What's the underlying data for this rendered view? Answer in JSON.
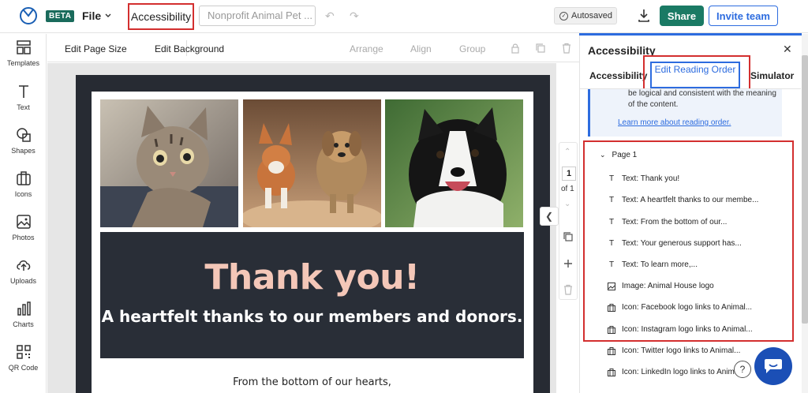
{
  "header": {
    "beta_label": "BETA",
    "file_label": "File",
    "accessibility_label": "Accessibility",
    "title_value": "Nonprofit Animal Pet ...",
    "autosaved_label": "Autosaved",
    "share_label": "Share",
    "invite_label": "Invite team"
  },
  "sidebar": {
    "items": [
      {
        "label": "Templates",
        "icon": "templates-icon"
      },
      {
        "label": "Text",
        "icon": "text-icon"
      },
      {
        "label": "Shapes",
        "icon": "shapes-icon"
      },
      {
        "label": "Icons",
        "icon": "icons-icon"
      },
      {
        "label": "Photos",
        "icon": "photos-icon"
      },
      {
        "label": "Uploads",
        "icon": "uploads-icon"
      },
      {
        "label": "Charts",
        "icon": "charts-icon"
      },
      {
        "label": "QR Code",
        "icon": "qr-code-icon"
      }
    ]
  },
  "toolbar": {
    "edit_page_size": "Edit Page Size",
    "edit_background": "Edit Background",
    "arrange": "Arrange",
    "align": "Align",
    "group": "Group"
  },
  "canvas": {
    "thank_you": "Thank you!",
    "heartfelt": "A heartfelt thanks to our members and donors.",
    "bottom_text": "From the bottom of our hearts,"
  },
  "page_controls": {
    "current": "1",
    "of_label": "of 1"
  },
  "panel": {
    "title": "Accessibility",
    "tabs": {
      "accessibility": "Accessibility",
      "edit_reading_order": "Edit Reading Order",
      "simulator": "Simulator"
    },
    "info_text": "be logical and consistent with the meaning of the content.",
    "info_link": "Learn more about reading order.",
    "page_group": "Page 1",
    "items": [
      {
        "icon": "text",
        "label": "Text: Thank you!"
      },
      {
        "icon": "text",
        "label": "Text: A heartfelt thanks to our membe..."
      },
      {
        "icon": "text",
        "label": "Text: From the bottom of our..."
      },
      {
        "icon": "text",
        "label": "Text: Your generous support has..."
      },
      {
        "icon": "text",
        "label": "Text: To learn more,..."
      },
      {
        "icon": "image",
        "label": "Image: Animal House logo"
      },
      {
        "icon": "icon",
        "label": "Icon: Facebook logo links to Animal..."
      },
      {
        "icon": "icon",
        "label": "Icon: Instagram logo links to Animal..."
      },
      {
        "icon": "icon",
        "label": "Icon: Twitter logo links to Animal..."
      },
      {
        "icon": "icon",
        "label": "Icon: LinkedIn logo links to Anima..."
      }
    ]
  },
  "colors": {
    "brand_green": "#1a7a64",
    "accent_blue": "#2d6cdf",
    "highlight_red": "#d32f2f",
    "banner_dark": "#292e37",
    "thank_peach": "#f4c7b8"
  }
}
